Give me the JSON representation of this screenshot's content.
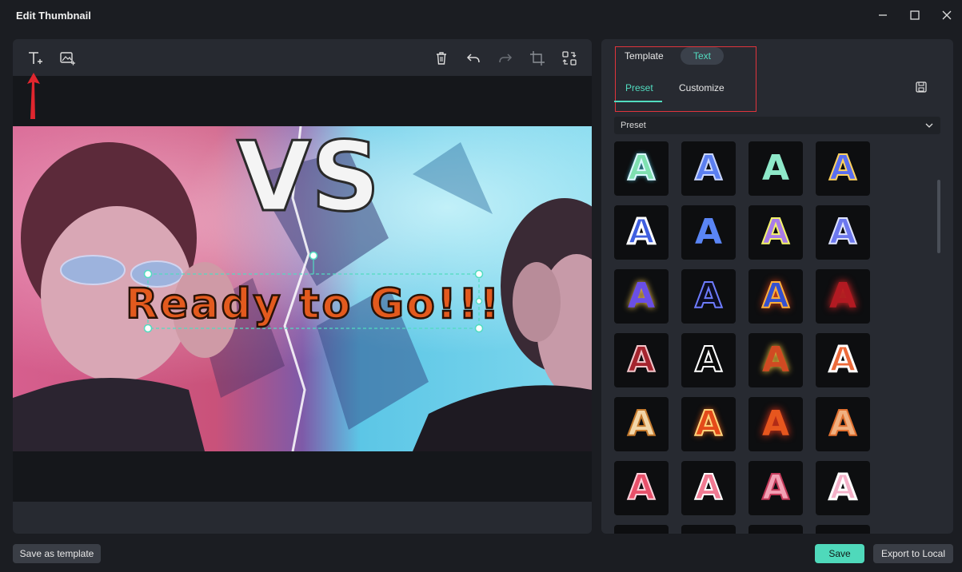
{
  "window": {
    "title": "Edit Thumbnail"
  },
  "canvas": {
    "headline": "Ready to Go!!!",
    "vs_text": "VS"
  },
  "panel": {
    "tab_template": "Template",
    "tab_text": "Text",
    "sub_preset": "Preset",
    "sub_customize": "Customize",
    "dropdown_value": "Preset",
    "preset_letter": "A"
  },
  "bottom": {
    "save_template_label": "Save as template",
    "save_label": "Save",
    "export_label": "Export to Local"
  },
  "colors": {
    "accent": "#4fd9bb",
    "highlight": "#e0343c"
  },
  "icons": [
    "add-text-icon",
    "add-image-icon",
    "delete-icon",
    "undo-icon",
    "redo-icon",
    "crop-icon",
    "replace-icon",
    "save-preset-icon",
    "chevron-down-icon",
    "minimize-icon",
    "maximize-icon",
    "close-icon"
  ]
}
